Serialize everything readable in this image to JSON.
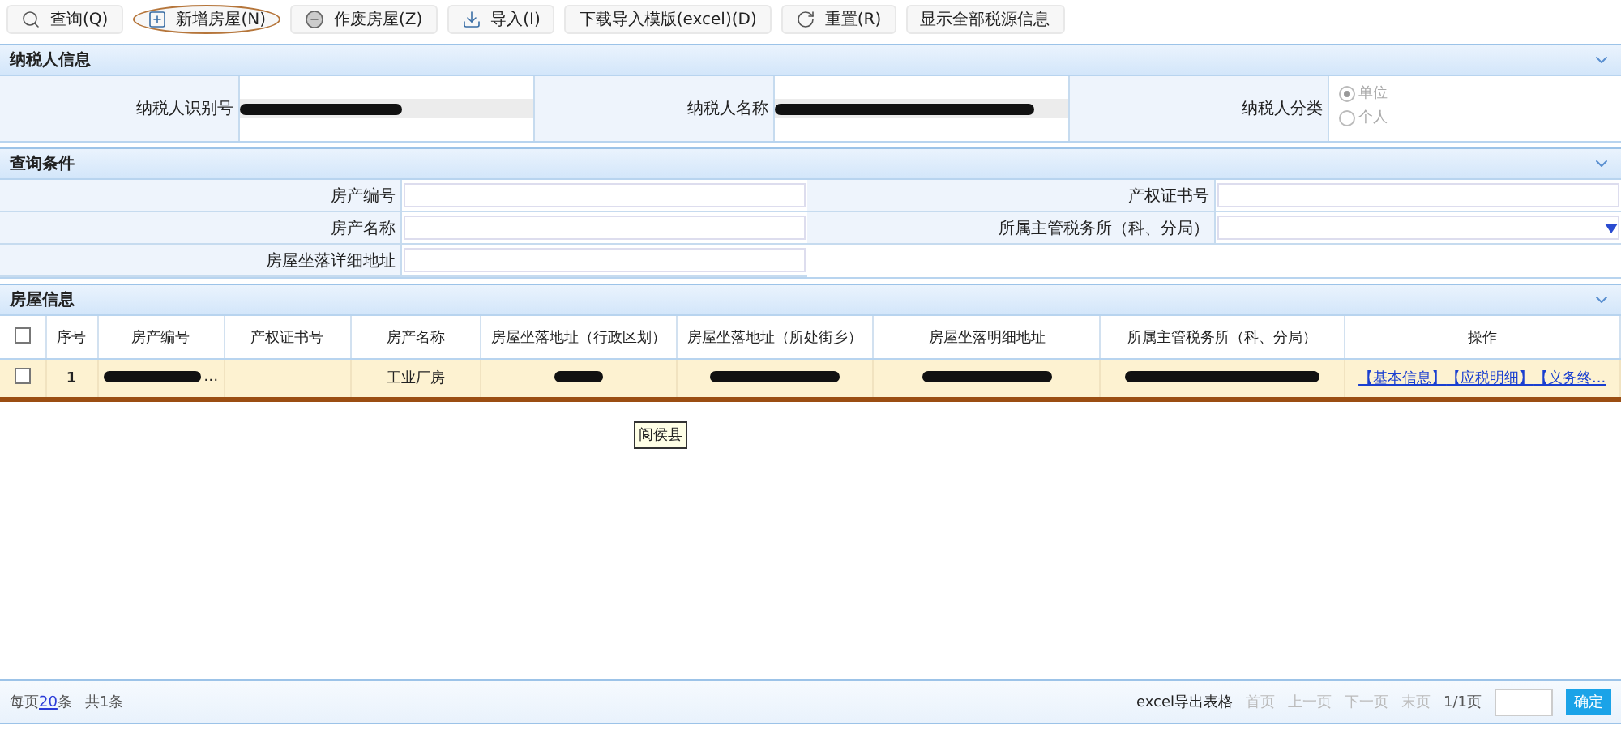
{
  "toolbar": [
    {
      "label": "查询(Q)",
      "kind": "search",
      "highlighted": false
    },
    {
      "label": "新增房屋(N)",
      "kind": "add",
      "highlighted": true
    },
    {
      "label": "作废房屋(Z)",
      "kind": "minus",
      "highlighted": false
    },
    {
      "label": "导入(I)",
      "kind": "import",
      "highlighted": false
    },
    {
      "label": "下载导入模版(excel)(D)",
      "kind": "plain",
      "highlighted": false
    },
    {
      "label": "重置(R)",
      "kind": "reset",
      "highlighted": false
    },
    {
      "label": "显示全部税源信息",
      "kind": "plain",
      "highlighted": false
    }
  ],
  "taxpayer": {
    "title": "纳税人信息",
    "id_label": "纳税人识别号",
    "id_redacted": true,
    "name_label": "纳税人名称",
    "name_redacted": true,
    "type_label": "纳税人分类",
    "types": [
      {
        "label": "单位",
        "selected": true
      },
      {
        "label": "个人",
        "selected": false
      }
    ]
  },
  "query": {
    "title": "查询条件",
    "fields": [
      {
        "label": "房产编号",
        "kind": "text"
      },
      {
        "label": "产权证书号",
        "kind": "text"
      },
      {
        "label": "房产名称",
        "kind": "text"
      },
      {
        "label": "所属主管税务所（科、分局）",
        "kind": "select"
      },
      {
        "label": "房屋坐落详细地址",
        "kind": "text"
      }
    ]
  },
  "houses": {
    "title": "房屋信息",
    "all_checked": false,
    "columns": [
      "序号",
      "房产编号",
      "产权证书号",
      "房产名称",
      "房屋坐落地址（行政区划）",
      "房屋坐落地址（所处街乡）",
      "房屋坐落明细地址",
      "所属主管税务所（科、分局）",
      "操作"
    ],
    "rows": [
      {
        "checked": false,
        "underlined": true,
        "cells": [
          {
            "text": "1",
            "redacted": false
          },
          {
            "text": "…",
            "redacted": true
          },
          {
            "text": "",
            "redacted": false
          },
          {
            "text": "工业厂房",
            "redacted": false
          },
          {
            "text": "",
            "redacted": true
          },
          {
            "text": "",
            "redacted": true
          },
          {
            "text": "",
            "redacted": true
          },
          {
            "text": "",
            "redacted": true
          }
        ],
        "actions": [
          "【基本信息】",
          "【应税明细】",
          "【义务终..."
        ]
      }
    ],
    "tooltip": "阆侯县"
  },
  "footer": {
    "page_size_prefix": "每页",
    "page_size": "20",
    "page_size_suffix": "条",
    "total": "共1条",
    "export": "excel导出表格",
    "pager": [
      "首页",
      "上一页",
      "下一页",
      "末页"
    ],
    "page": "1/1页",
    "confirm": "确定"
  }
}
